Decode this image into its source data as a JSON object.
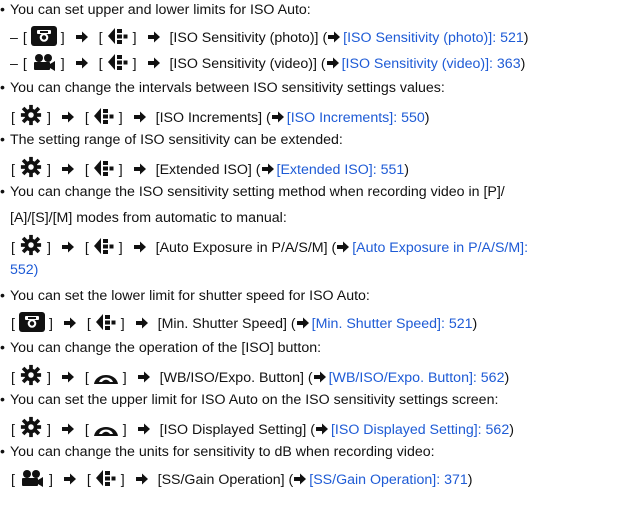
{
  "bullets": [
    "You can set upper and lower limits for ISO Auto:",
    "You can change the intervals between ISO sensitivity settings values:",
    "The setting range of ISO sensitivity can be extended:",
    "You can change the ISO sensitivity setting method when recording video in [P]/",
    "[A]/[S]/[M] modes from automatic to manual:",
    "You can set the lower limit for shutter speed for ISO Auto:",
    "You can change the operation of the [ISO] button:",
    "You can set the upper limit for ISO Auto on the ISO sensitivity settings screen:",
    "You can change the units for sensitivity to dB when recording video:"
  ],
  "dash": "–",
  "menus": [
    {
      "item": "[ISO Sensitivity (photo)]",
      "link": "[ISO Sensitivity (photo)]: 521"
    },
    {
      "item": "[ISO Sensitivity (video)]",
      "link": "[ISO Sensitivity (video)]: 363"
    },
    {
      "item": "[ISO Increments]",
      "link": "[ISO Increments]: 550"
    },
    {
      "item": "[Extended ISO]",
      "link": "[Extended ISO]: 551"
    },
    {
      "item": "[Auto Exposure in P/A/S/M]",
      "link": "[Auto Exposure in P/A/S/M]:",
      "link_cont": "552)"
    },
    {
      "item": "[Min. Shutter Speed]",
      "link": "[Min. Shutter Speed]: 521"
    },
    {
      "item": "[WB/ISO/Expo. Button]",
      "link": "[WB/ISO/Expo. Button]: 562"
    },
    {
      "item": "[ISO Displayed Setting]",
      "link": "[ISO Displayed Setting]: 562"
    },
    {
      "item": "[SS/Gain Operation]",
      "link": "[SS/Gain Operation]: 371"
    }
  ],
  "icons": {
    "camera": "camera-icon",
    "video": "video-camera-icon",
    "gear": "gear-icon",
    "menu_tab": "creative-menu-tab-icon",
    "operation_tab": "operation-tab-icon",
    "arrow": "right-arrow-icon"
  }
}
